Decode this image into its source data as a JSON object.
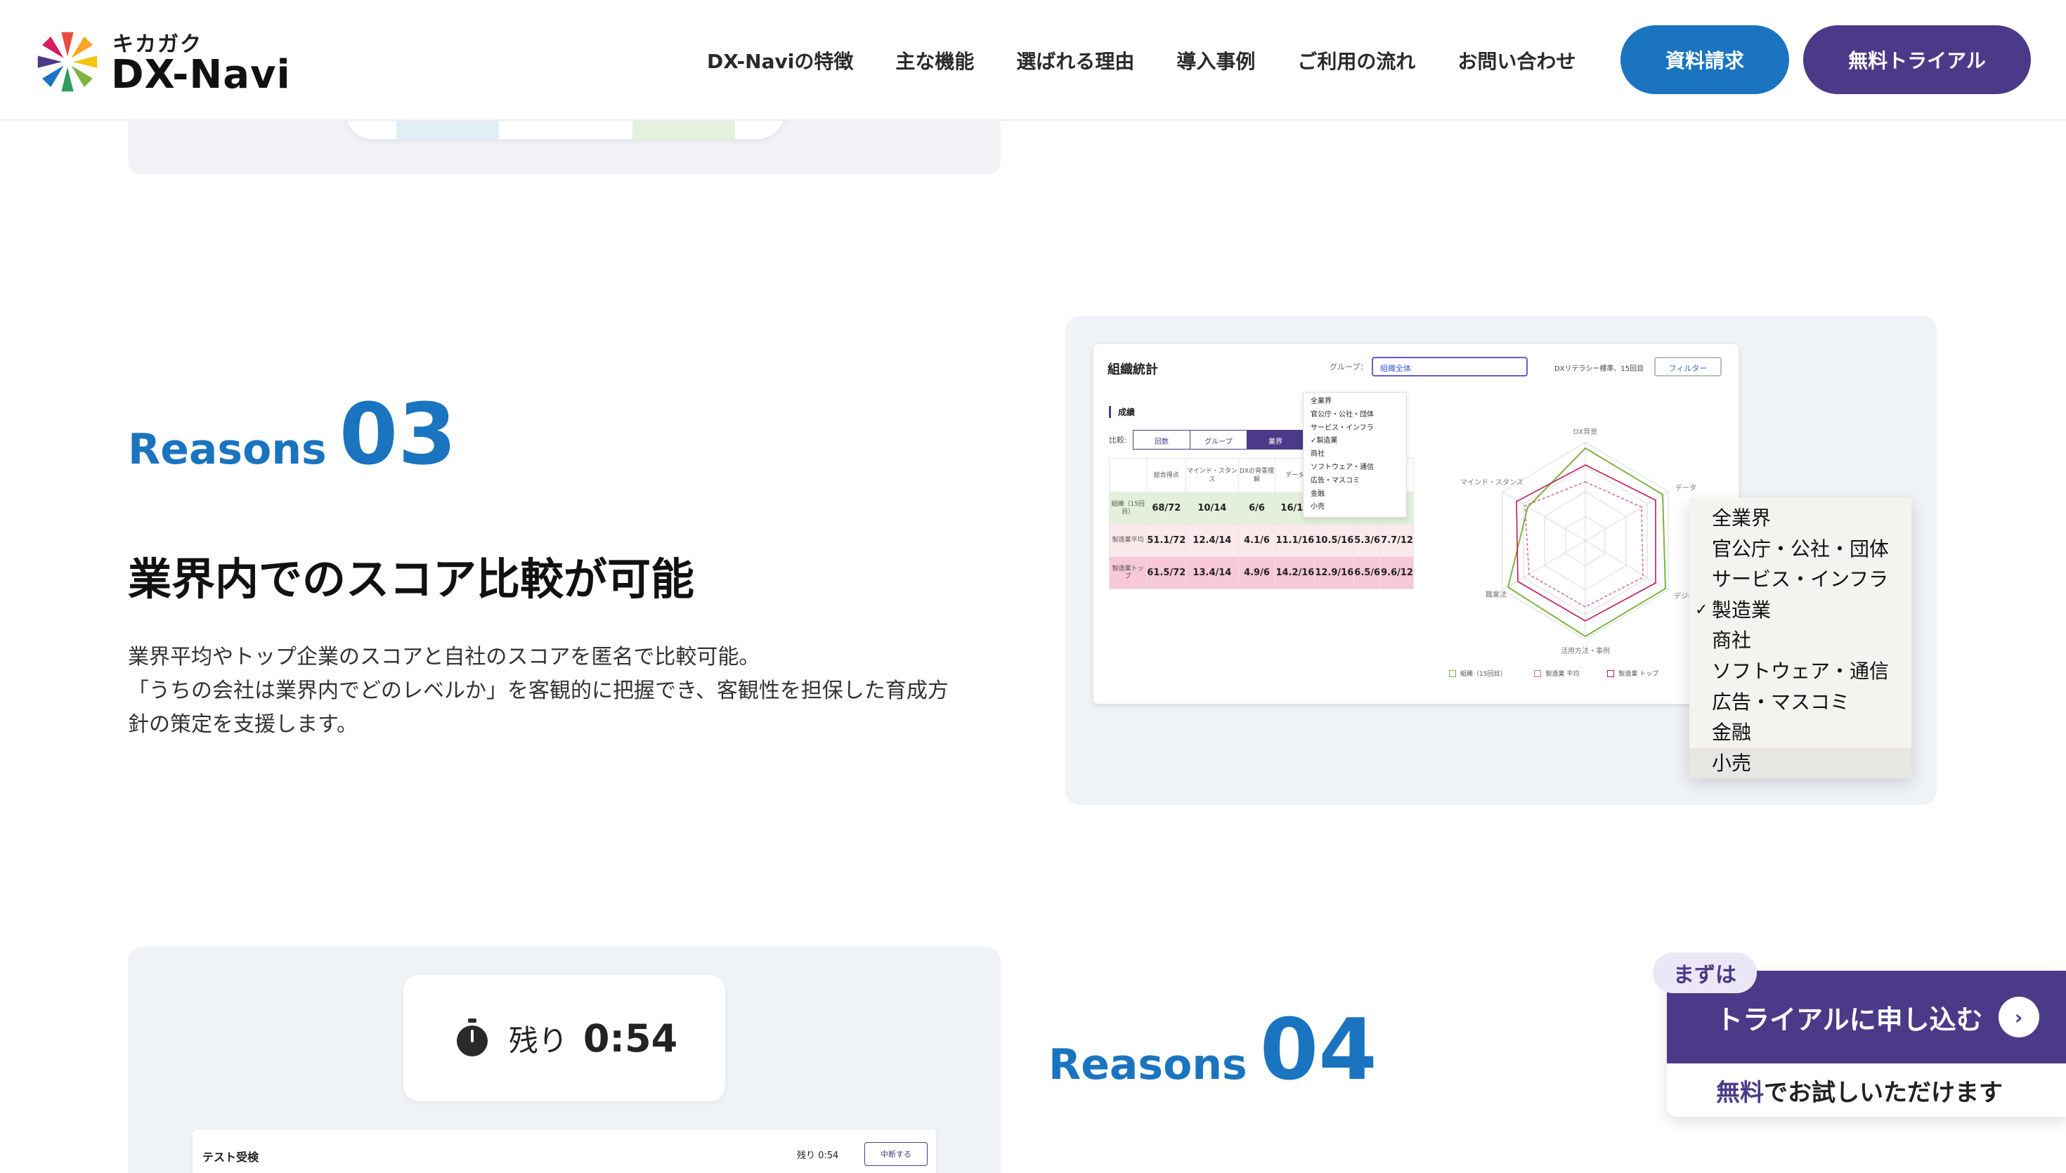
{
  "header": {
    "logo_sub": "キカガク",
    "logo_main": "DX-Navi",
    "nav": [
      "DX-Naviの特徴",
      "主な機能",
      "選ばれる理由",
      "導入事例",
      "ご利用の流れ",
      "お問い合わせ"
    ],
    "docs_button": "資料請求",
    "trial_button": "無料トライアル"
  },
  "reason3": {
    "word": "Reasons",
    "number": "03",
    "title": "業界内でのスコア比較が可能",
    "body": [
      "業界平均やトップ企業のスコアと自社のスコアを匿名で比較可能。",
      "「うちの会社は業界内でどのレベルか」を客観的に把握でき、客観性を担保した育成方",
      "針の策定を支援します。"
    ]
  },
  "screenshot": {
    "title": "組織統計",
    "group_label": "グループ：",
    "group_value": "組織全体",
    "meta": "DXリテラシー標準、15回目",
    "filter": "フィルター",
    "score_label": "成績",
    "compare_label": "比較:",
    "segments": [
      "回数",
      "グループ",
      "業界"
    ],
    "columns": [
      "",
      "総合得点",
      "マインド・スタンス",
      "DXの背景理解",
      "データ",
      "",
      "",
      ""
    ],
    "rows": [
      {
        "label": "組織（15回目）",
        "cells": [
          "68/72",
          "10/14",
          "6/6",
          "16/16",
          "",
          "",
          ""
        ]
      },
      {
        "label": "製造業平均",
        "cells": [
          "51.1/72",
          "12.4/14",
          "4.1/6",
          "11.1/16",
          "10.5/16",
          "5.3/6",
          "7.7/12"
        ]
      },
      {
        "label": "製造業トップ",
        "cells": [
          "61.5/72",
          "13.4/14",
          "4.9/6",
          "14.2/16",
          "12.9/16",
          "6.5/6",
          "9.6/12"
        ]
      }
    ],
    "small_dropdown": [
      "全業界",
      "官公庁・公社・団体",
      "サービス・インフラ",
      "✓製造業",
      "商社",
      "ソフトウェア・通信",
      "広告・マスコミ",
      "金融",
      "小売"
    ],
    "radar_axes": [
      "DX背景",
      "データ",
      "デジタル技術",
      "活用方法・事例",
      "職業法",
      "マインド・スタンス"
    ],
    "legend": [
      "組織（15回目）",
      "製造業 平均",
      "製造業 トップ"
    ]
  },
  "industry_dropdown": {
    "options": [
      "全業界",
      "官公庁・公社・団体",
      "サービス・インフラ",
      "製造業",
      "商社",
      "ソフトウェア・通信",
      "広告・マスコミ",
      "金融",
      "小売"
    ],
    "selected": "製造業",
    "highlighted": "小売"
  },
  "reason4": {
    "word": "Reasons",
    "number": "04",
    "timer_label": "残り",
    "timer_value": "0:54",
    "test_title": "テスト受検",
    "test_timer": "残り 0:54",
    "test_stop": "中断する"
  },
  "cta": {
    "tag": "まずは",
    "main": "トライアルに申し込む",
    "sub_free": "無料",
    "sub_rest": "でお試しいただけます"
  },
  "colors": {
    "brand_blue": "#1a74bf",
    "brand_purple": "#4b3a87"
  }
}
